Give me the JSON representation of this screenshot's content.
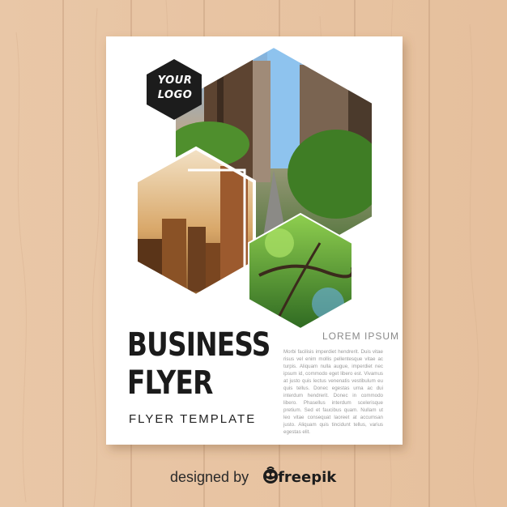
{
  "flyer": {
    "logo": {
      "line1": "YOUR",
      "line2": "LOGO"
    },
    "title": {
      "line1": "BUSINESS",
      "line2": "FLYER"
    },
    "subtitle": "FLYER TEMPLATE",
    "section_heading": "LOREM IPSUM",
    "body_text": "Morbi facilisis imperdiet hendrerit. Duis vitae risus vel enim mollis pellentesque vitae ac turpis. Aliquam nulla augue, imperdiet nec ipsum id, commodo eget libero est. Vivamus at justo quis lectus venenatis vestibulum eu quis tellus. Donec egestas urna ac dui interdum hendrerit. Donec in commodo libero. Phasellus interdum scelerisque pretium. Sed et faucibus quam. Nullam ut leo vitae consequat laoreet at accumsan justo. Aliquam quis tincidunt tellus, varius egestas elit."
  },
  "credit": {
    "prefix": "designed by",
    "brand": "freepik",
    "icon": "freepik-logo-icon"
  },
  "colors": {
    "wood_base": "#e8c4a3",
    "paper": "#ffffff",
    "title_text": "#1b1b1b",
    "logo_bg": "#1c1c1c",
    "muted_text": "#9a9a9a"
  }
}
